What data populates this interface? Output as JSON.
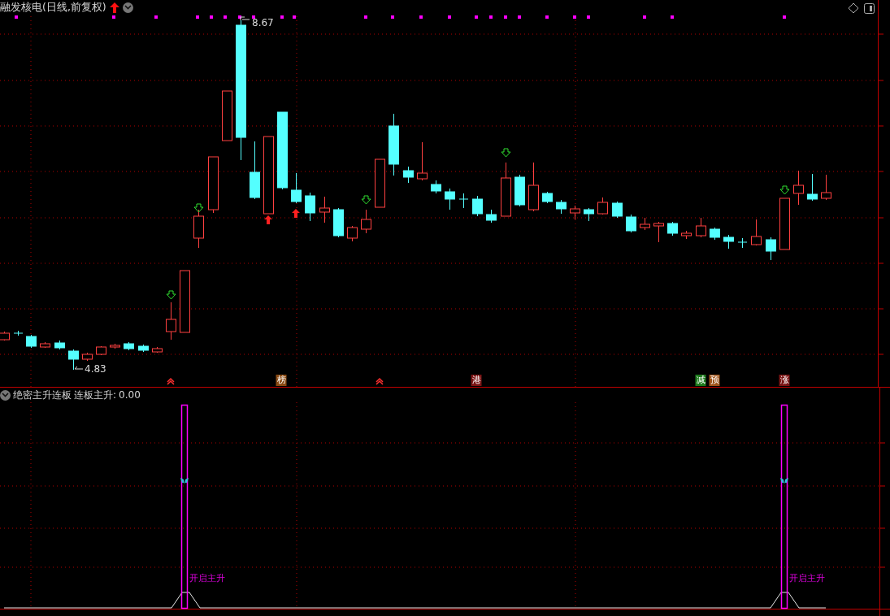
{
  "title": "融发核电(日线,前复权)",
  "price_labels": {
    "high": "8.67",
    "low": "4.83"
  },
  "events": [
    {
      "label": "榜",
      "color": "#8a4a12"
    },
    {
      "label": "港",
      "color": "#7a1414"
    },
    {
      "label": "减",
      "color": "#1d7a1d"
    },
    {
      "label": "预",
      "color": "#a0541a"
    },
    {
      "label": "涨",
      "color": "#7a1414"
    }
  ],
  "indicator": {
    "name": "绝密主升连板",
    "reading_label": "连板主升:",
    "reading": "0.00"
  },
  "signals": [
    {
      "label": "开启主升"
    },
    {
      "label": "开启主升"
    }
  ]
}
